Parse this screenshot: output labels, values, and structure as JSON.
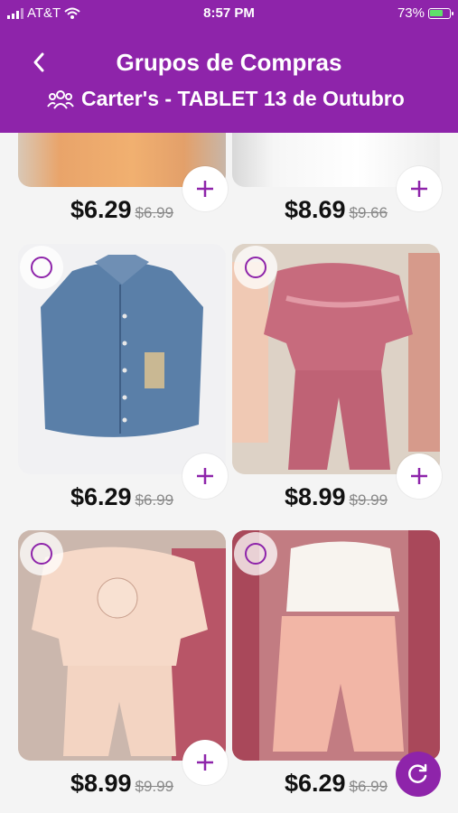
{
  "status_bar": {
    "carrier": "AT&T",
    "time": "8:57 PM",
    "battery": "73%"
  },
  "header": {
    "title": "Grupos de Compras",
    "subtitle": "Carter's - TABLET 13 de Outubro"
  },
  "products": [
    {
      "price": "$6.29",
      "old_price": "$6.99"
    },
    {
      "price": "$8.69",
      "old_price": "$9.66"
    },
    {
      "price": "$6.29",
      "old_price": "$6.99"
    },
    {
      "price": "$8.99",
      "old_price": "$9.99"
    },
    {
      "price": "$8.99",
      "old_price": "$9.99"
    },
    {
      "price": "$6.29",
      "old_price": "$6.99"
    }
  ],
  "colors": {
    "accent": "#8e24aa",
    "background": "#f4f4f4"
  }
}
